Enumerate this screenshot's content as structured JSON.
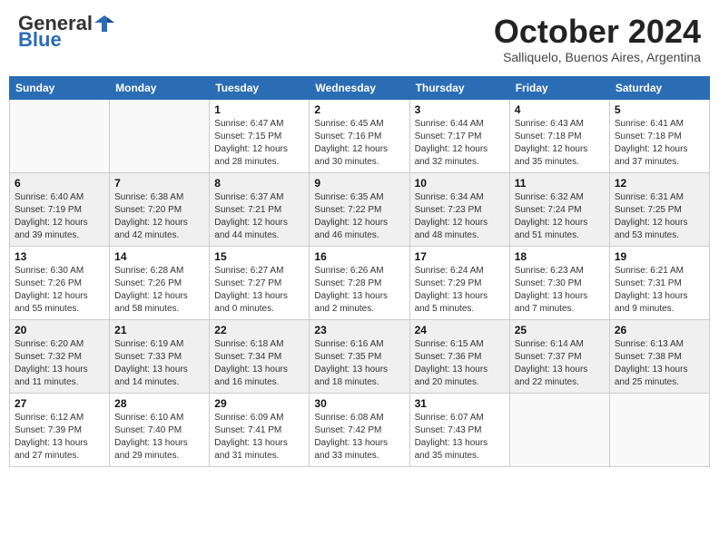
{
  "header": {
    "logo_general": "General",
    "logo_blue": "Blue",
    "month_title": "October 2024",
    "location": "Salliquelo, Buenos Aires, Argentina"
  },
  "weekdays": [
    "Sunday",
    "Monday",
    "Tuesday",
    "Wednesday",
    "Thursday",
    "Friday",
    "Saturday"
  ],
  "weeks": [
    {
      "shaded": false,
      "days": [
        {
          "num": "",
          "info": "",
          "empty": true
        },
        {
          "num": "",
          "info": "",
          "empty": true
        },
        {
          "num": "1",
          "info": "Sunrise: 6:47 AM\nSunset: 7:15 PM\nDaylight: 12 hours\nand 28 minutes.",
          "empty": false
        },
        {
          "num": "2",
          "info": "Sunrise: 6:45 AM\nSunset: 7:16 PM\nDaylight: 12 hours\nand 30 minutes.",
          "empty": false
        },
        {
          "num": "3",
          "info": "Sunrise: 6:44 AM\nSunset: 7:17 PM\nDaylight: 12 hours\nand 32 minutes.",
          "empty": false
        },
        {
          "num": "4",
          "info": "Sunrise: 6:43 AM\nSunset: 7:18 PM\nDaylight: 12 hours\nand 35 minutes.",
          "empty": false
        },
        {
          "num": "5",
          "info": "Sunrise: 6:41 AM\nSunset: 7:18 PM\nDaylight: 12 hours\nand 37 minutes.",
          "empty": false
        }
      ]
    },
    {
      "shaded": true,
      "days": [
        {
          "num": "6",
          "info": "Sunrise: 6:40 AM\nSunset: 7:19 PM\nDaylight: 12 hours\nand 39 minutes.",
          "empty": false
        },
        {
          "num": "7",
          "info": "Sunrise: 6:38 AM\nSunset: 7:20 PM\nDaylight: 12 hours\nand 42 minutes.",
          "empty": false
        },
        {
          "num": "8",
          "info": "Sunrise: 6:37 AM\nSunset: 7:21 PM\nDaylight: 12 hours\nand 44 minutes.",
          "empty": false
        },
        {
          "num": "9",
          "info": "Sunrise: 6:35 AM\nSunset: 7:22 PM\nDaylight: 12 hours\nand 46 minutes.",
          "empty": false
        },
        {
          "num": "10",
          "info": "Sunrise: 6:34 AM\nSunset: 7:23 PM\nDaylight: 12 hours\nand 48 minutes.",
          "empty": false
        },
        {
          "num": "11",
          "info": "Sunrise: 6:32 AM\nSunset: 7:24 PM\nDaylight: 12 hours\nand 51 minutes.",
          "empty": false
        },
        {
          "num": "12",
          "info": "Sunrise: 6:31 AM\nSunset: 7:25 PM\nDaylight: 12 hours\nand 53 minutes.",
          "empty": false
        }
      ]
    },
    {
      "shaded": false,
      "days": [
        {
          "num": "13",
          "info": "Sunrise: 6:30 AM\nSunset: 7:26 PM\nDaylight: 12 hours\nand 55 minutes.",
          "empty": false
        },
        {
          "num": "14",
          "info": "Sunrise: 6:28 AM\nSunset: 7:26 PM\nDaylight: 12 hours\nand 58 minutes.",
          "empty": false
        },
        {
          "num": "15",
          "info": "Sunrise: 6:27 AM\nSunset: 7:27 PM\nDaylight: 13 hours\nand 0 minutes.",
          "empty": false
        },
        {
          "num": "16",
          "info": "Sunrise: 6:26 AM\nSunset: 7:28 PM\nDaylight: 13 hours\nand 2 minutes.",
          "empty": false
        },
        {
          "num": "17",
          "info": "Sunrise: 6:24 AM\nSunset: 7:29 PM\nDaylight: 13 hours\nand 5 minutes.",
          "empty": false
        },
        {
          "num": "18",
          "info": "Sunrise: 6:23 AM\nSunset: 7:30 PM\nDaylight: 13 hours\nand 7 minutes.",
          "empty": false
        },
        {
          "num": "19",
          "info": "Sunrise: 6:21 AM\nSunset: 7:31 PM\nDaylight: 13 hours\nand 9 minutes.",
          "empty": false
        }
      ]
    },
    {
      "shaded": true,
      "days": [
        {
          "num": "20",
          "info": "Sunrise: 6:20 AM\nSunset: 7:32 PM\nDaylight: 13 hours\nand 11 minutes.",
          "empty": false
        },
        {
          "num": "21",
          "info": "Sunrise: 6:19 AM\nSunset: 7:33 PM\nDaylight: 13 hours\nand 14 minutes.",
          "empty": false
        },
        {
          "num": "22",
          "info": "Sunrise: 6:18 AM\nSunset: 7:34 PM\nDaylight: 13 hours\nand 16 minutes.",
          "empty": false
        },
        {
          "num": "23",
          "info": "Sunrise: 6:16 AM\nSunset: 7:35 PM\nDaylight: 13 hours\nand 18 minutes.",
          "empty": false
        },
        {
          "num": "24",
          "info": "Sunrise: 6:15 AM\nSunset: 7:36 PM\nDaylight: 13 hours\nand 20 minutes.",
          "empty": false
        },
        {
          "num": "25",
          "info": "Sunrise: 6:14 AM\nSunset: 7:37 PM\nDaylight: 13 hours\nand 22 minutes.",
          "empty": false
        },
        {
          "num": "26",
          "info": "Sunrise: 6:13 AM\nSunset: 7:38 PM\nDaylight: 13 hours\nand 25 minutes.",
          "empty": false
        }
      ]
    },
    {
      "shaded": false,
      "days": [
        {
          "num": "27",
          "info": "Sunrise: 6:12 AM\nSunset: 7:39 PM\nDaylight: 13 hours\nand 27 minutes.",
          "empty": false
        },
        {
          "num": "28",
          "info": "Sunrise: 6:10 AM\nSunset: 7:40 PM\nDaylight: 13 hours\nand 29 minutes.",
          "empty": false
        },
        {
          "num": "29",
          "info": "Sunrise: 6:09 AM\nSunset: 7:41 PM\nDaylight: 13 hours\nand 31 minutes.",
          "empty": false
        },
        {
          "num": "30",
          "info": "Sunrise: 6:08 AM\nSunset: 7:42 PM\nDaylight: 13 hours\nand 33 minutes.",
          "empty": false
        },
        {
          "num": "31",
          "info": "Sunrise: 6:07 AM\nSunset: 7:43 PM\nDaylight: 13 hours\nand 35 minutes.",
          "empty": false
        },
        {
          "num": "",
          "info": "",
          "empty": true
        },
        {
          "num": "",
          "info": "",
          "empty": true
        }
      ]
    }
  ]
}
